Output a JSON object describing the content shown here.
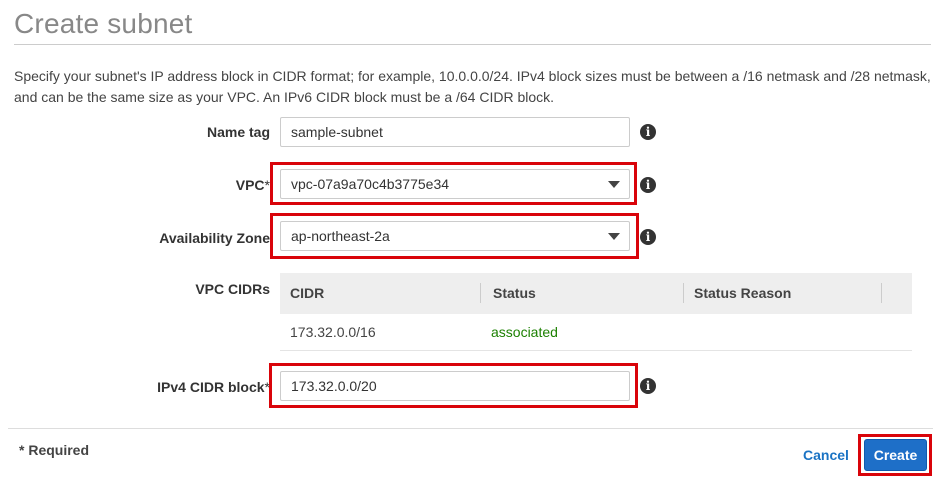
{
  "page": {
    "title": "Create subnet",
    "description": "Specify your subnet's IP address block in CIDR format; for example, 10.0.0.0/24. IPv4 block sizes must be between a /16 netmask and /28 netmask, and can be the same size as your VPC. An IPv6 CIDR block must be a /64 CIDR block."
  },
  "form": {
    "name_tag": {
      "label": "Name tag",
      "value": "sample-subnet"
    },
    "vpc": {
      "label": "VPC",
      "required_mark": "*",
      "selected": "vpc-07a9a70c4b3775e34"
    },
    "availability_zone": {
      "label": "Availability Zone",
      "selected": "ap-northeast-2a"
    },
    "vpc_cidrs": {
      "label": "VPC CIDRs",
      "columns": [
        "CIDR",
        "Status",
        "Status Reason"
      ],
      "rows": [
        {
          "cidr": "173.32.0.0/16",
          "status": "associated",
          "status_reason": ""
        }
      ]
    },
    "ipv4_cidr_block": {
      "label": "IPv4 CIDR block",
      "required_mark": "*",
      "value": "173.32.0.0/20"
    }
  },
  "footer": {
    "required_note": "* Required",
    "cancel_label": "Cancel",
    "create_label": "Create"
  },
  "icons": {
    "info": "info-icon",
    "dropdown": "chevron-down-icon"
  },
  "colors": {
    "highlight": "#d9040a",
    "primary_button": "#1e6fc8",
    "link": "#1a73c4",
    "status_ok": "#1d8102"
  }
}
